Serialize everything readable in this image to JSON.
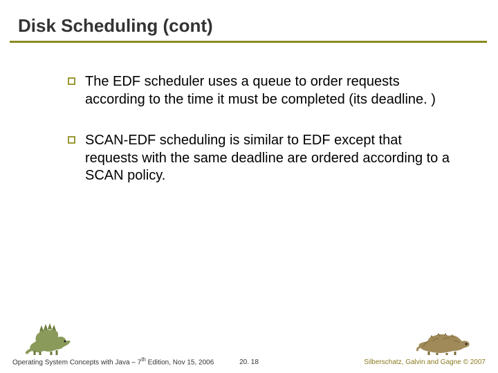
{
  "title": "Disk Scheduling (cont)",
  "bullets": [
    "The EDF scheduler uses a queue to order requests  according to the time it must be completed (its deadline. )",
    "SCAN-EDF scheduling is similar to EDF except that requests with the same deadline are ordered according to a SCAN policy."
  ],
  "footer": {
    "left_prefix": "Operating System Concepts with Java – 7",
    "left_sup": "th",
    "left_suffix": " Edition, Nov 15, 2006",
    "center": "20. 18",
    "right": "Silberschatz, Galvin and Gagne © 2007"
  }
}
